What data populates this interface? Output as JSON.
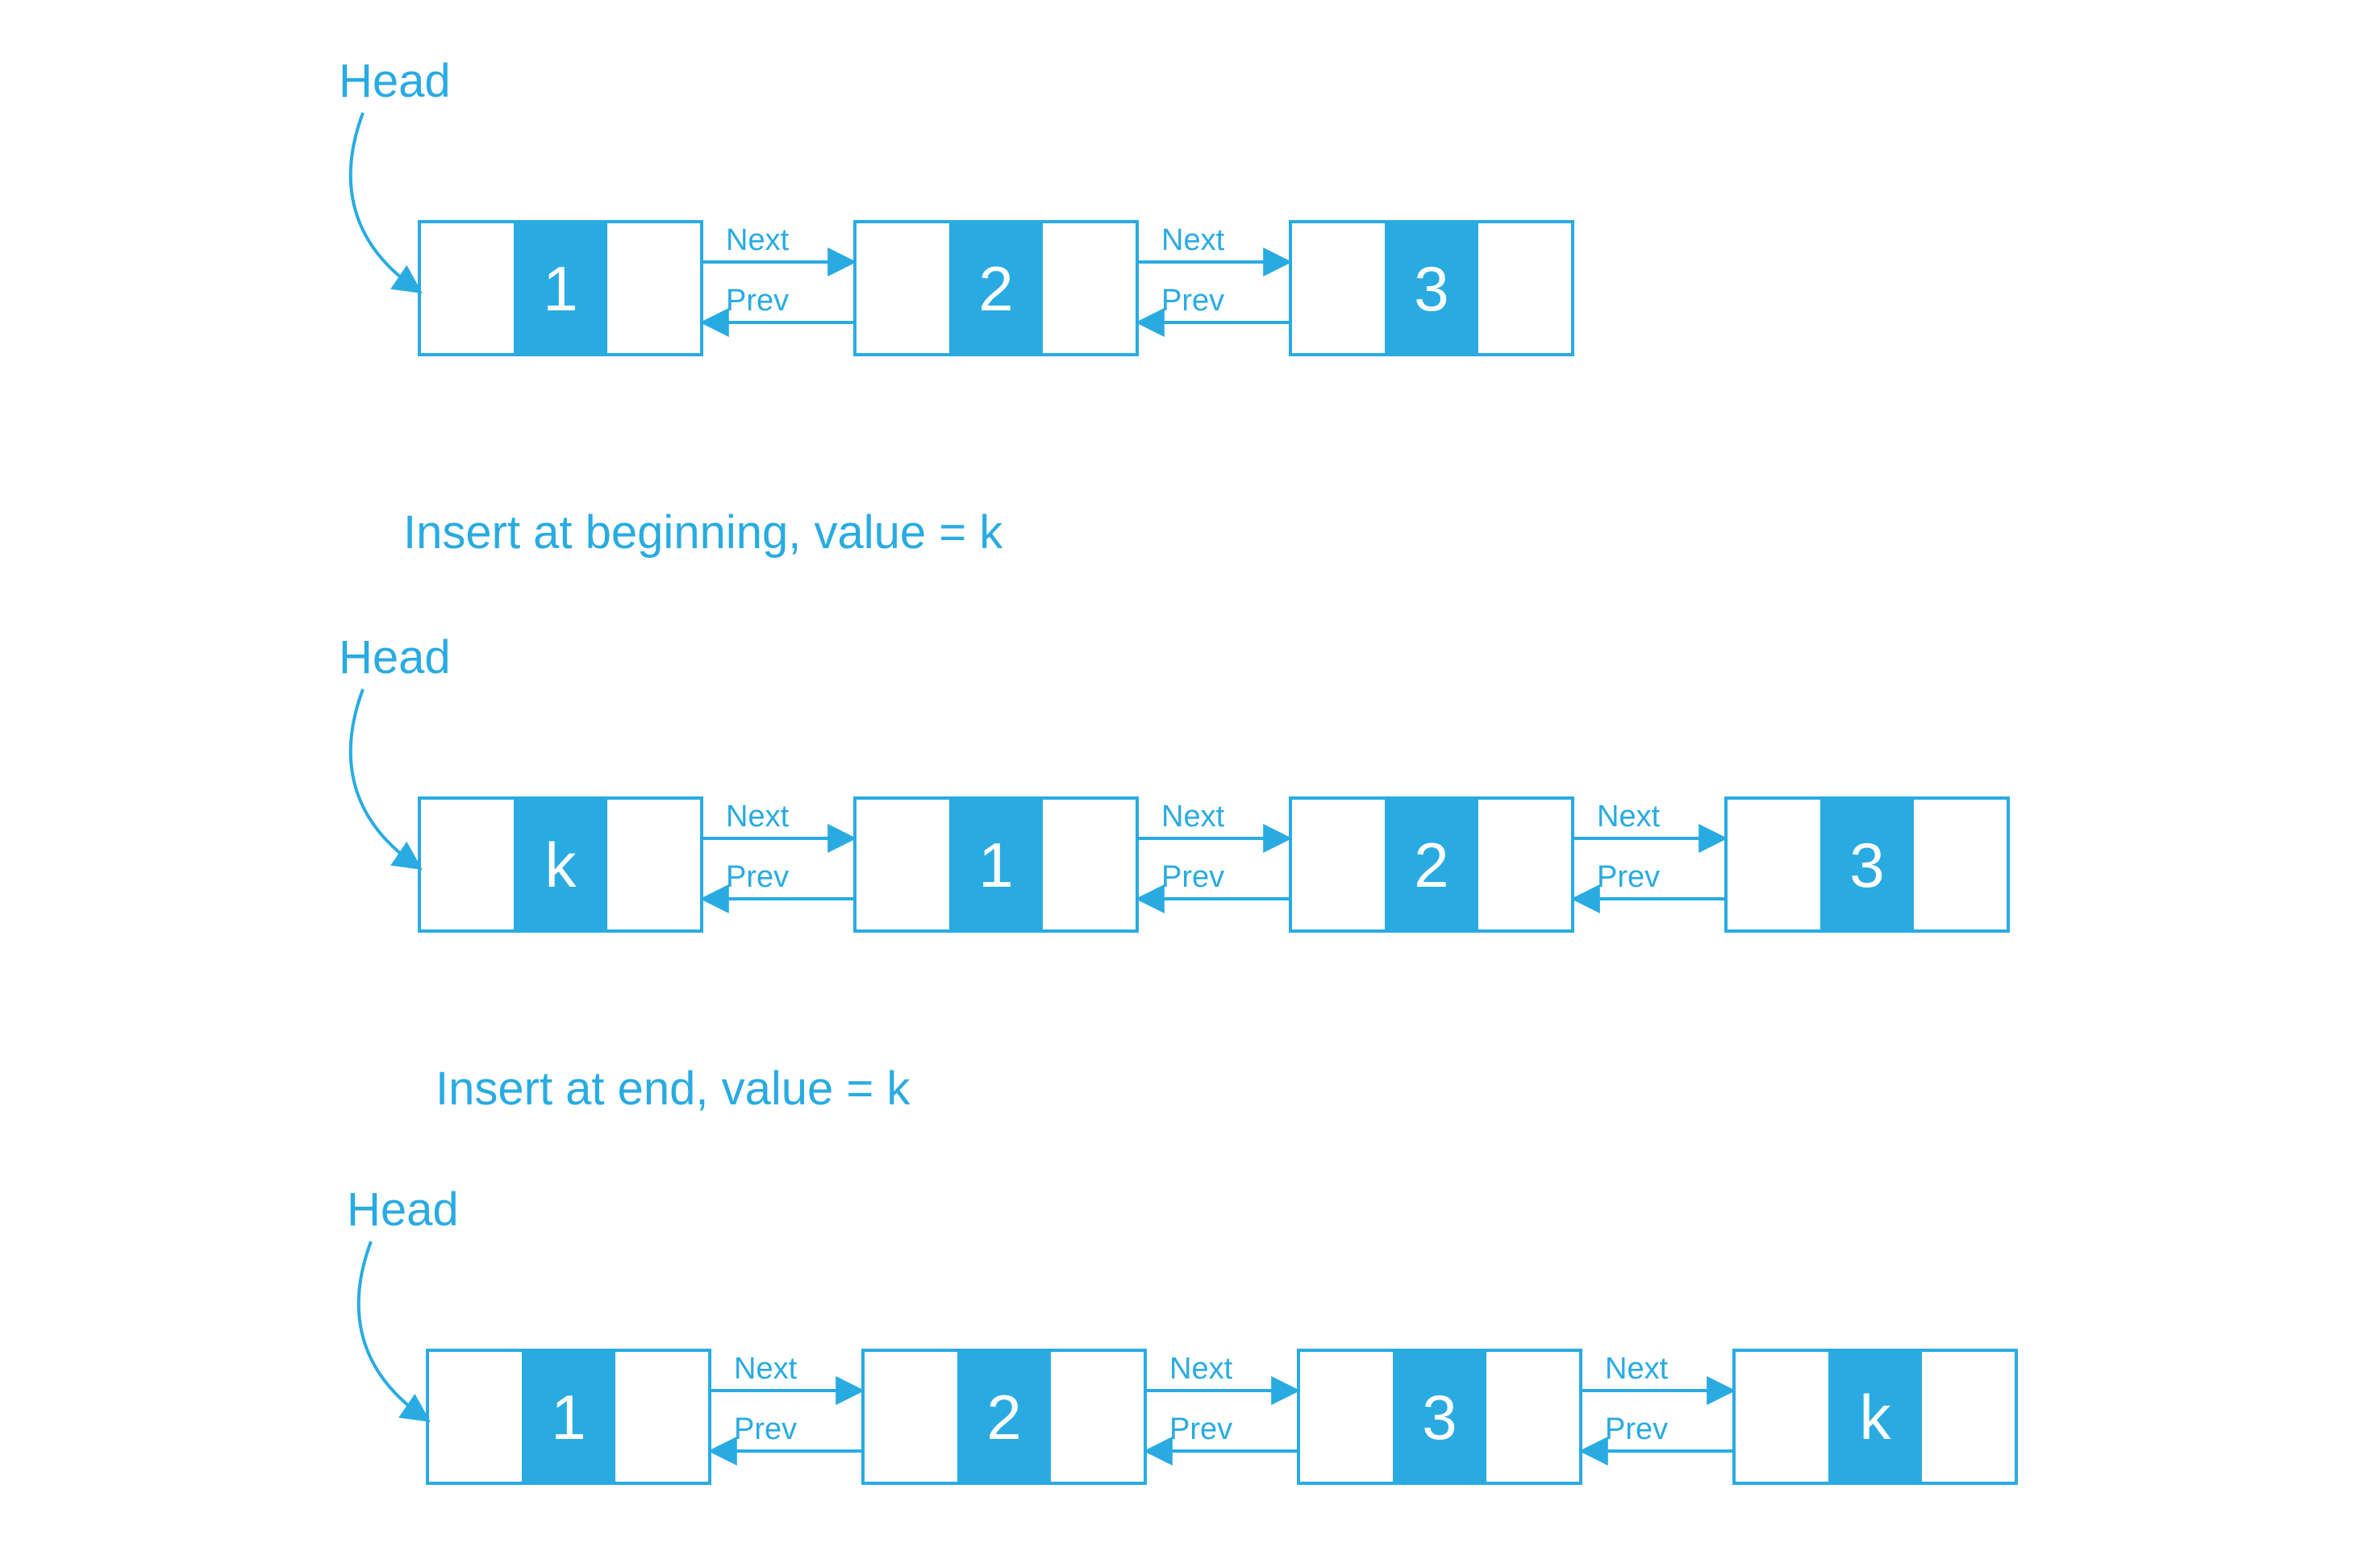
{
  "color": "#29abe2",
  "head_label": "Head",
  "next_label": "Next",
  "prev_label": "Prev",
  "captions": {
    "insert_begin": "Insert at beginning, value = k",
    "insert_end": "Insert at end, value = k"
  },
  "rows": [
    {
      "id": "initial",
      "nodes": [
        "1",
        "2",
        "3"
      ]
    },
    {
      "id": "insert-begin",
      "nodes": [
        "k",
        "1",
        "2",
        "3"
      ]
    },
    {
      "id": "insert-end",
      "nodes": [
        "1",
        "2",
        "3",
        "k"
      ]
    }
  ]
}
